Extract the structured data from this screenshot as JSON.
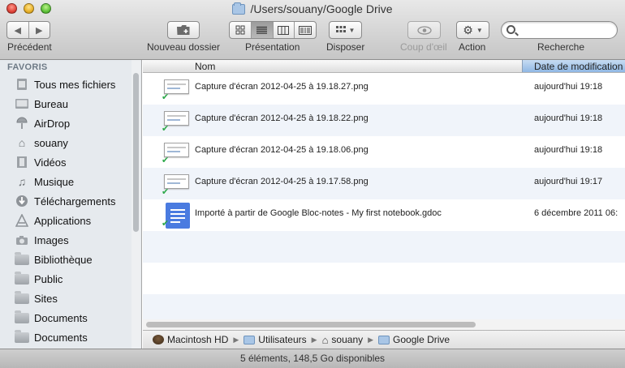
{
  "window": {
    "title": "/Users/souany/Google Drive"
  },
  "toolbar": {
    "back_label": "Précédent",
    "new_folder_label": "Nouveau dossier",
    "presentation_label": "Présentation",
    "arrange_label": "Disposer",
    "quicklook_label": "Coup d'œil",
    "action_label": "Action",
    "search_label": "Recherche",
    "search_placeholder": ""
  },
  "sidebar": {
    "header": "FAVORIS",
    "items": [
      {
        "label": "Tous mes fichiers",
        "icon": "all-files-icon"
      },
      {
        "label": "Bureau",
        "icon": "desktop-icon"
      },
      {
        "label": "AirDrop",
        "icon": "airdrop-icon"
      },
      {
        "label": "souany",
        "icon": "home-icon"
      },
      {
        "label": "Vidéos",
        "icon": "movies-icon"
      },
      {
        "label": "Musique",
        "icon": "music-icon"
      },
      {
        "label": "Téléchargements",
        "icon": "downloads-icon"
      },
      {
        "label": "Applications",
        "icon": "applications-icon"
      },
      {
        "label": "Images",
        "icon": "camera-icon"
      },
      {
        "label": "Bibliothèque",
        "icon": "folder-icon"
      },
      {
        "label": "Public",
        "icon": "folder-icon"
      },
      {
        "label": "Sites",
        "icon": "folder-icon"
      },
      {
        "label": "Documents",
        "icon": "folder-icon"
      },
      {
        "label": "Documents",
        "icon": "folder-icon"
      }
    ]
  },
  "columns": {
    "name": "Nom",
    "date": "Date de modification"
  },
  "files": [
    {
      "name": "Capture d'écran 2012-04-25 à 19.18.27.png",
      "date": "aujourd'hui 19:18",
      "kind": "image"
    },
    {
      "name": "Capture d'écran 2012-04-25 à 19.18.22.png",
      "date": "aujourd'hui 19:18",
      "kind": "image"
    },
    {
      "name": "Capture d'écran 2012-04-25 à 19.18.06.png",
      "date": "aujourd'hui 19:18",
      "kind": "image"
    },
    {
      "name": "Capture d'écran 2012-04-25 à 19.17.58.png",
      "date": "aujourd'hui 19:17",
      "kind": "image"
    },
    {
      "name": "Importé à partir de Google Bloc-notes - My first notebook.gdoc",
      "date": "6 décembre 2011 06:",
      "kind": "gdoc"
    }
  ],
  "pathbar": {
    "items": [
      "Macintosh HD",
      "Utilisateurs",
      "souany",
      "Google Drive"
    ]
  },
  "status": "5 éléments, 148,5 Go disponibles",
  "colors": {
    "sidebar_bg": "#e6eaee",
    "selected_column": "#8fb7e4",
    "alt_row": "#f0f4fa",
    "sync_check": "#2da84a",
    "gdoc_blue": "#4a7be0"
  }
}
